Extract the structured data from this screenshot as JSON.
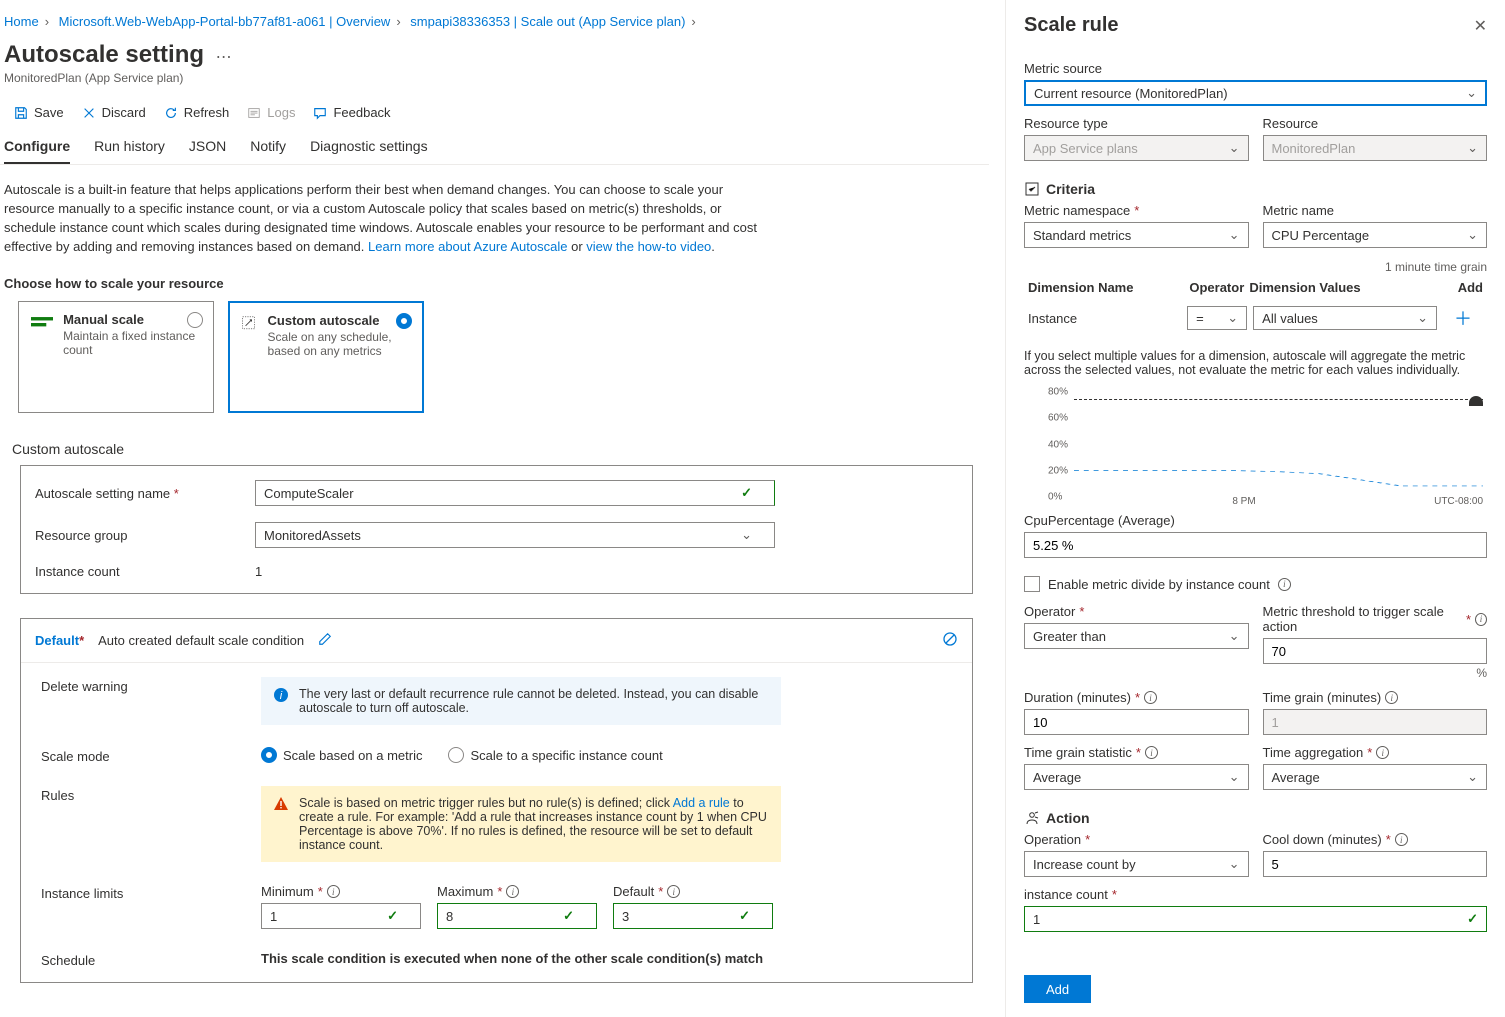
{
  "breadcrumb": [
    {
      "label": "Home"
    },
    {
      "label": "Microsoft.Web-WebApp-Portal-bb77af81-a061 | Overview"
    },
    {
      "label": "smpapi38336353 | Scale out (App Service plan)"
    }
  ],
  "page": {
    "title": "Autoscale setting",
    "subtitle": "MonitoredPlan (App Service plan)"
  },
  "toolbar": {
    "save": "Save",
    "discard": "Discard",
    "refresh": "Refresh",
    "logs": "Logs",
    "feedback": "Feedback"
  },
  "tabs": [
    "Configure",
    "Run history",
    "JSON",
    "Notify",
    "Diagnostic settings"
  ],
  "description": {
    "text": "Autoscale is a built-in feature that helps applications perform their best when demand changes. You can choose to scale your resource manually to a specific instance count, or via a custom Autoscale policy that scales based on metric(s) thresholds, or schedule instance count which scales during designated time windows. Autoscale enables your resource to be performant and cost effective by adding and removing instances based on demand. ",
    "learn": "Learn more about Azure Autoscale",
    "or": " or ",
    "howto": "view the how-to video",
    "dot": "."
  },
  "chooseLabel": "Choose how to scale your resource",
  "choices": {
    "manual": {
      "title": "Manual scale",
      "desc": "Maintain a fixed instance count"
    },
    "custom": {
      "title": "Custom autoscale",
      "desc": "Scale on any schedule, based on any metrics"
    }
  },
  "customHeader": "Custom autoscale",
  "form": {
    "nameLabel": "Autoscale setting name",
    "nameValue": "ComputeScaler",
    "rgLabel": "Resource group",
    "rgValue": "MonitoredAssets",
    "countLabel": "Instance count",
    "countValue": "1"
  },
  "cond": {
    "name": "Default",
    "subtitle": "Auto created default scale condition",
    "deleteLabel": "Delete warning",
    "deleteMsg": "The very last or default recurrence rule cannot be deleted. Instead, you can disable autoscale to turn off autoscale.",
    "scaleModeLabel": "Scale mode",
    "modeMetric": "Scale based on a metric",
    "modeFixed": "Scale to a specific instance count",
    "rulesLabel": "Rules",
    "rulesMsg1": "Scale is based on metric trigger rules but no rule(s) is defined; click ",
    "rulesLink": "Add a rule",
    "rulesMsg2": " to create a rule. For example: 'Add a rule that increases instance count by 1 when CPU Percentage is above 70%'. If no rules is defined, the resource will be set to default instance count.",
    "limitsLabel": "Instance limits",
    "min": "Minimum",
    "minVal": "1",
    "max": "Maximum",
    "maxVal": "8",
    "def": "Default",
    "defVal": "3",
    "scheduleLabel": "Schedule",
    "scheduleMsg": "This scale condition is executed when none of the other scale condition(s) match"
  },
  "blade": {
    "title": "Scale rule",
    "metricSourceLabel": "Metric source",
    "metricSourceValue": "Current resource (MonitoredPlan)",
    "resourceTypeLabel": "Resource type",
    "resourceTypeValue": "App Service plans",
    "resourceLabel": "Resource",
    "resourceValue": "MonitoredPlan",
    "criteria": "Criteria",
    "metricNsLabel": "Metric namespace",
    "metricNsValue": "Standard metrics",
    "metricNameLabel": "Metric name",
    "metricNameValue": "CPU Percentage",
    "timeGrainNote": "1 minute time grain",
    "dimHead": {
      "name": "Dimension Name",
      "op": "Operator",
      "vals": "Dimension Values",
      "add": "Add"
    },
    "dimRow": {
      "name": "Instance",
      "op": "=",
      "vals": "All values"
    },
    "multiNote": "If you select multiple values for a dimension, autoscale will aggregate the metric across the selected values, not evaluate the metric for each values individually.",
    "cpLabel": "CpuPercentage (Average)",
    "cpValue": "5.25 %",
    "enableDivide": "Enable metric divide by instance count",
    "operatorLabel": "Operator",
    "operatorValue": "Greater than",
    "thresholdLabel": "Metric threshold to trigger scale action",
    "thresholdValue": "70",
    "pct": "%",
    "durationLabel": "Duration (minutes)",
    "durationValue": "10",
    "tgMinLabel": "Time grain (minutes)",
    "tgMinValue": "1",
    "tgStatLabel": "Time grain statistic",
    "tgStatValue": "Average",
    "tAggLabel": "Time aggregation",
    "tAggValue": "Average",
    "action": "Action",
    "operationLabel": "Operation",
    "operationValue": "Increase count by",
    "cooldownLabel": "Cool down (minutes)",
    "cooldownValue": "5",
    "instCountLabel": "instance count",
    "instCountValue": "1",
    "addBtn": "Add"
  },
  "chart_data": {
    "type": "line",
    "title": "",
    "ylabel": "",
    "xlabel": "",
    "ylim": [
      0,
      80
    ],
    "yticks": [
      0,
      20,
      40,
      60,
      80
    ],
    "xticks": [
      "8 PM",
      "UTC-08:00"
    ],
    "threshold": 70,
    "series": [
      {
        "name": "CpuPercentage",
        "x": [
          0,
          1,
          2,
          3,
          4,
          5,
          6,
          7,
          8,
          9
        ],
        "values": [
          9,
          9,
          9,
          9,
          9,
          8,
          7,
          4,
          1,
          1
        ]
      }
    ]
  }
}
